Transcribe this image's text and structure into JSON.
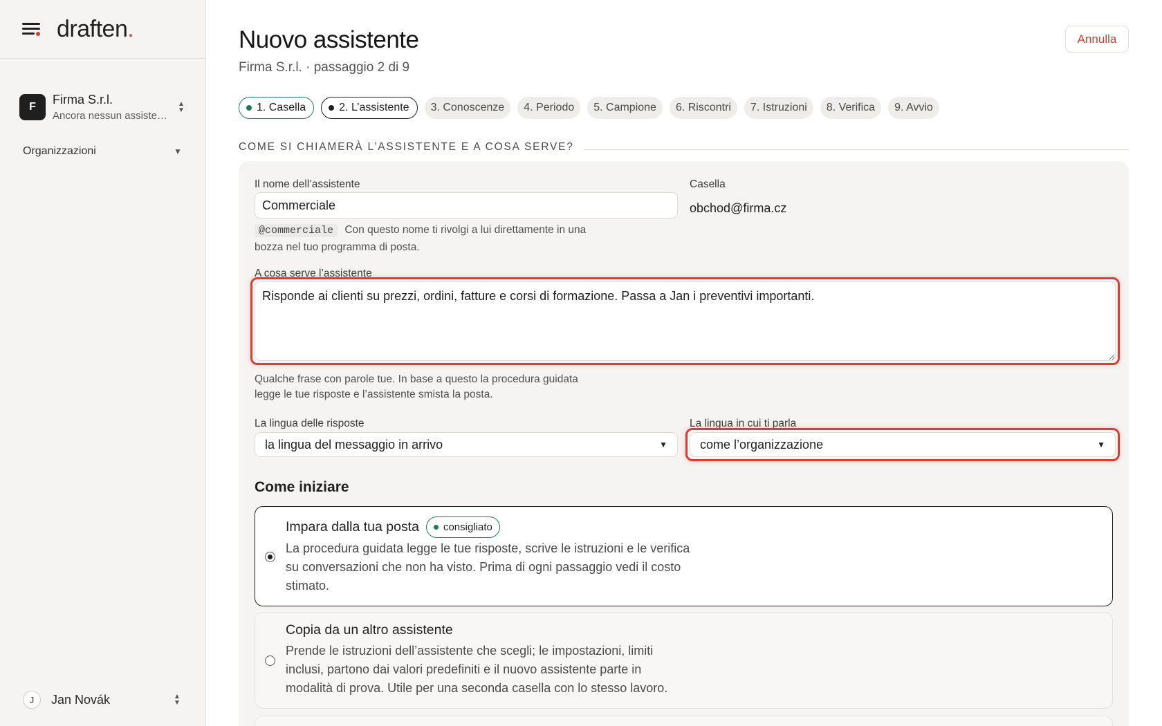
{
  "sidebar": {
    "logo": "draften",
    "logo_dot": ".",
    "org": {
      "avatar": "F",
      "name": "Firma S.r.l.",
      "subtitle": "Ancora nessun assistente"
    },
    "section_label": "Organizzazioni",
    "user": {
      "avatar": "J",
      "name": "Jan Novák"
    }
  },
  "header": {
    "title": "Nuovo assistente",
    "subtitle": "Firma S.r.l. · passaggio 2 di 9",
    "cancel_label": "Annulla"
  },
  "steps": [
    {
      "label": "1. Casella",
      "state": "done"
    },
    {
      "label": "2. L’assistente",
      "state": "current"
    },
    {
      "label": "3. Conoscenze",
      "state": "todo"
    },
    {
      "label": "4. Periodo",
      "state": "todo"
    },
    {
      "label": "5. Campione",
      "state": "todo"
    },
    {
      "label": "6. Riscontri",
      "state": "todo"
    },
    {
      "label": "7. Istruzioni",
      "state": "todo"
    },
    {
      "label": "8. Verifica",
      "state": "todo"
    },
    {
      "label": "9. Avvio",
      "state": "todo"
    }
  ],
  "form": {
    "section_heading": "COME SI CHIAMERÀ L’ASSISTENTE E A COSA SERVE?",
    "name_label": "Il nome dell’assistente",
    "name_value": "Commerciale",
    "handle": "@commerciale",
    "name_help_1": "Con questo nome ti rivolgi a lui direttamente in una",
    "name_help_2": "bozza nel tuo programma di posta.",
    "mailbox_label": "Casella",
    "mailbox_value": "obchod@firma.cz",
    "purpose_label": "A cosa serve l’assistente",
    "purpose_value": "Risponde ai clienti su prezzi, ordini, fatture e corsi di formazione. Passa a Jan i preventivi importanti.",
    "purpose_help_1": "Qualche frase con parole tue. In base a questo la procedura guidata",
    "purpose_help_2": "legge le tue risposte e l’assistente smista la posta.",
    "reply_lang_label": "La lingua delle risposte",
    "reply_lang_value": "la lingua del messaggio in arrivo",
    "talk_lang_label": "La lingua in cui ti parla",
    "talk_lang_value": "come l’organizzazione"
  },
  "start": {
    "heading": "Come iniziare",
    "options": [
      {
        "title": "Impara dalla tua posta",
        "badge": "consigliato",
        "desc": "La procedura guidata legge le tue risposte, scrive le istruzioni e le verifica su conversazioni che non ha visto. Prima di ogni passaggio vedi il costo stimato.",
        "selected": true
      },
      {
        "title": "Copia da un altro assistente",
        "desc": "Prende le istruzioni dell’assistente che scegli; le impostazioni, limiti inclusi, partono dai valori predefiniti e il nuovo assistente parte in modalità di prova. Utile per una seconda casella con lo stesso lavoro.",
        "selected": false
      }
    ]
  },
  "colors": {
    "accent_red": "#d6412f",
    "accent_green": "#1d7a5a",
    "sidebar_bg": "#f5f4f2"
  }
}
